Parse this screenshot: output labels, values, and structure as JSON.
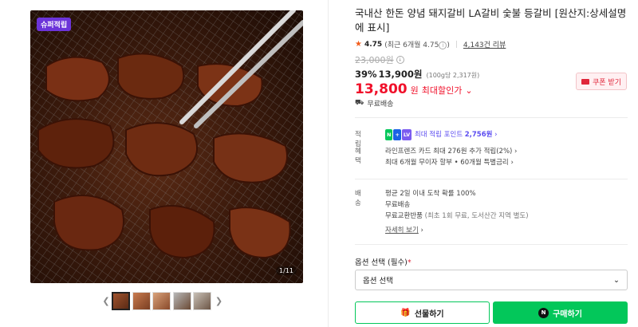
{
  "gallery": {
    "badge": "슈퍼적립",
    "counter": "1/11",
    "thumb_count": 5,
    "prev_icon": "chevron-left-icon",
    "next_icon": "chevron-right-icon"
  },
  "product": {
    "title": "국내산 한돈 양념 돼지갈비 LA갈비 숯불 등갈비 [원산지:상세설명에 표시]",
    "rating": "4.75",
    "rating_detail": "(최근 6개월 4.75",
    "review_count": "4,143건 리뷰",
    "original_price": "23,000원",
    "discount_rate": "39%",
    "sale_price": "13,900원",
    "unit_price": "(100g당 2,317원)",
    "max_price": "13,800",
    "max_price_unit": "원",
    "max_label": "최대할인가",
    "coupon_label": "쿠폰 받기",
    "shipping_label": "무료배송"
  },
  "benefits": {
    "point_key": "적립",
    "point_text": "최대 적립 포인트",
    "point_value": "2,756원",
    "benefit_key": "혜택",
    "benefit_line1": "라인프렌즈 카드 최대 276원 추가 적립(2%)",
    "benefit_line2": "최대 6개월 무이자 할부 • 60개월 특별금리"
  },
  "delivery": {
    "key": "배송",
    "line1": "평균 2일 이내 도착 확률 100%",
    "line2": "무료배송",
    "line3_a": "무료교환반품",
    "line3_b": "(최초 1회 무료, 도서산간 지역 별도)",
    "detail_link": "자세히 보기"
  },
  "options": {
    "label": "옵션 선택 (필수)",
    "required_mark": "*",
    "select_value": "옵션 선택"
  },
  "actions": {
    "gift_label": "선물하기",
    "buy_label": "구매하기"
  },
  "colors": {
    "accent_green": "#03c75a",
    "price_red": "#f0102a",
    "badge_purple": "#6c34d9"
  }
}
